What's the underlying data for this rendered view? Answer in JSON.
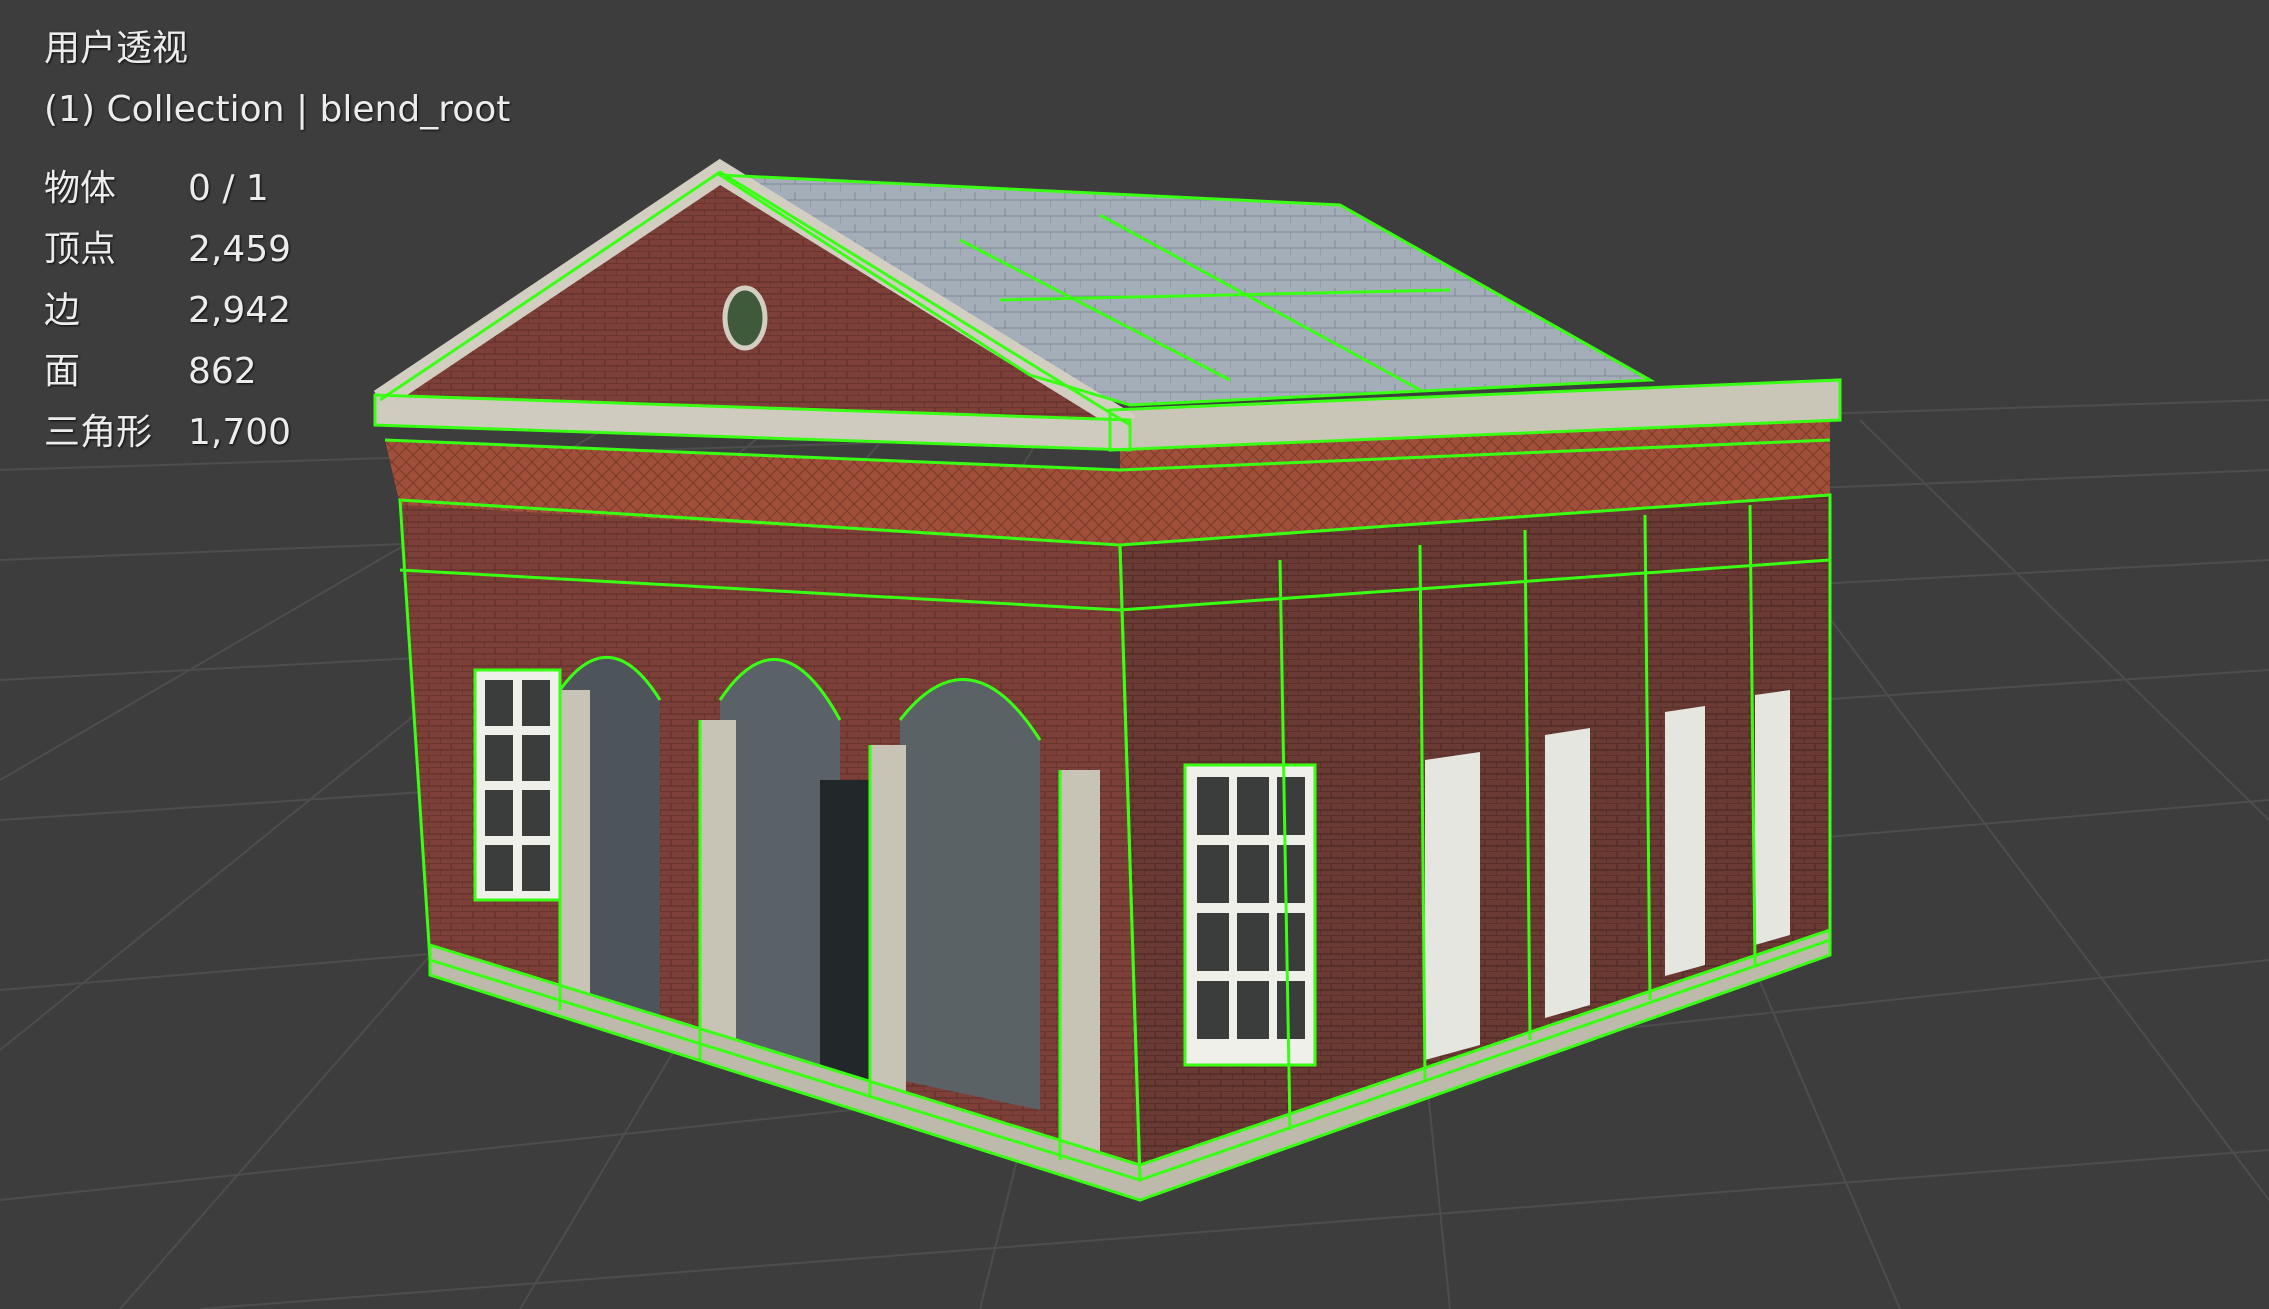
{
  "viewport": {
    "view_name": "用户透视",
    "collection_line": "(1) Collection | blend_root"
  },
  "statistics": [
    {
      "label": "物体",
      "value": "0 / 1"
    },
    {
      "label": "顶点",
      "value": "2,459"
    },
    {
      "label": "边",
      "value": "2,942"
    },
    {
      "label": "面",
      "value": "862"
    },
    {
      "label": "三角形",
      "value": "1,700"
    }
  ],
  "colors": {
    "background": "#3d3d3d",
    "grid": "#4a4a4a",
    "wireframe_selected": "#39ff14",
    "brick": "#8a4a42",
    "brick_dark": "#6e3a34",
    "stone_trim": "#b9b6a8",
    "roof": "#9aa6b2",
    "window_frame": "#f2f2ee",
    "doorway": "#5b6266"
  },
  "scene": {
    "object": "brick pavilion building with pediment, arched portico and tiled roof",
    "display_mode": "solid with selected wireframe overlay"
  }
}
